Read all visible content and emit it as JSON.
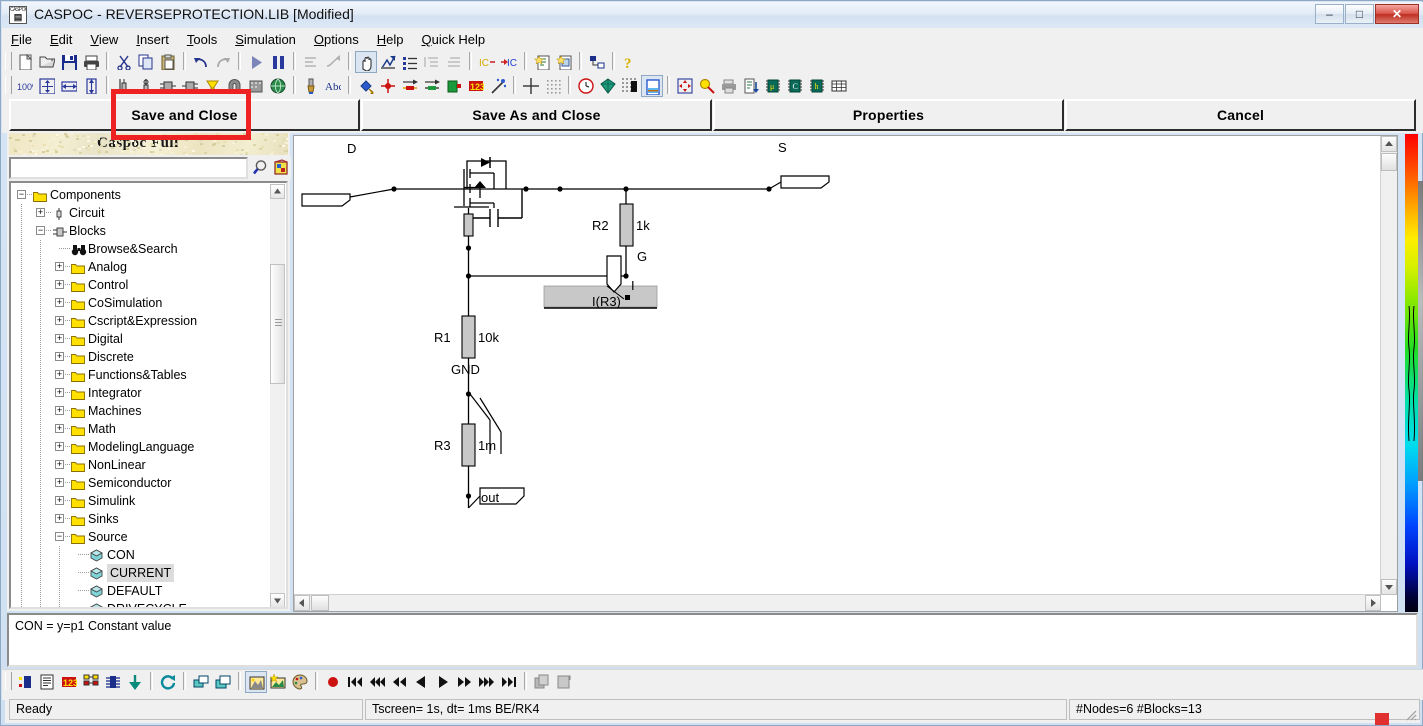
{
  "window": {
    "title": "CASPOC - REVERSEPROTECTION.LIB [Modified]",
    "icon_name": "caspoc-app-icon",
    "minimize_label": "–",
    "maximize_label": "□",
    "close_label": "✕"
  },
  "menu": [
    {
      "label": "File",
      "accel": "F"
    },
    {
      "label": "Edit",
      "accel": "E"
    },
    {
      "label": "View",
      "accel": "V"
    },
    {
      "label": "Insert",
      "accel": "I"
    },
    {
      "label": "Tools",
      "accel": "T"
    },
    {
      "label": "Simulation",
      "accel": "S"
    },
    {
      "label": "Options",
      "accel": "O"
    },
    {
      "label": "Help",
      "accel": "H"
    },
    {
      "label": "Quick Help",
      "accel": "Q"
    }
  ],
  "toolbar_row1": [
    {
      "name": "new-file-icon",
      "title": "New"
    },
    {
      "name": "open-folder-icon",
      "title": "Open"
    },
    {
      "name": "save-disk-icon",
      "title": "Save"
    },
    {
      "name": "print-icon",
      "title": "Print"
    },
    {
      "name": "separator"
    },
    {
      "name": "cut-scissors-icon",
      "title": "Cut"
    },
    {
      "name": "copy-icon",
      "title": "Copy"
    },
    {
      "name": "paste-clipboard-icon",
      "title": "Paste"
    },
    {
      "name": "separator"
    },
    {
      "name": "undo-arrow-icon",
      "title": "Undo"
    },
    {
      "name": "redo-arrow-icon",
      "title": "Redo"
    },
    {
      "name": "separator"
    },
    {
      "name": "play-run-icon",
      "title": "Run"
    },
    {
      "name": "pause-icon",
      "title": "Pause"
    },
    {
      "name": "separator"
    },
    {
      "name": "align-left-icon",
      "title": "Align"
    },
    {
      "name": "wire-route-icon",
      "title": "Route"
    },
    {
      "name": "separator"
    },
    {
      "name": "pan-hand-icon",
      "title": "Pan",
      "pressed": true
    },
    {
      "name": "scope-probe-icon",
      "title": "Scope"
    },
    {
      "name": "list-icon",
      "title": "List"
    },
    {
      "name": "indent-in-icon",
      "title": "Indent"
    },
    {
      "name": "indent-out-icon",
      "title": "Outdent"
    },
    {
      "name": "separator"
    },
    {
      "name": "initial-condition-out-icon",
      "title": "IC out"
    },
    {
      "name": "initial-condition-in-icon",
      "title": "IC in"
    },
    {
      "name": "separator"
    },
    {
      "name": "new-sheet-star-icon",
      "title": "New sheet"
    },
    {
      "name": "new-page-star-icon",
      "title": "New page"
    },
    {
      "name": "separator"
    },
    {
      "name": "hierarchy-icon",
      "title": "Hierarchy"
    },
    {
      "name": "separator"
    },
    {
      "name": "help-question-icon",
      "title": "Help"
    }
  ],
  "toolbar_row2": [
    {
      "name": "zoom-100-icon",
      "title": "100%"
    },
    {
      "name": "zoom-fit-icon",
      "title": "Zoom fit"
    },
    {
      "name": "zoom-width-icon",
      "title": "Zoom width"
    },
    {
      "name": "zoom-height-icon",
      "title": "Zoom height"
    },
    {
      "name": "separator"
    },
    {
      "name": "component-pin-icon",
      "title": "Pin"
    },
    {
      "name": "node-icon",
      "title": "Node"
    },
    {
      "name": "block-in-icon",
      "title": "Block in"
    },
    {
      "name": "block-out-icon",
      "title": "Block out"
    },
    {
      "name": "lamp-icon",
      "title": "Lamp"
    },
    {
      "name": "magnet-icon",
      "title": "Magnet"
    },
    {
      "name": "machine-icon",
      "title": "Machine"
    },
    {
      "name": "globe-icon",
      "title": "Global"
    },
    {
      "name": "separator"
    },
    {
      "name": "paint-brush-icon",
      "title": "Brush"
    },
    {
      "name": "text-abc-icon",
      "title": "Text"
    },
    {
      "name": "separator"
    },
    {
      "name": "color-fill-icon",
      "title": "Fill color"
    },
    {
      "name": "add-node-red-icon",
      "title": "Add node"
    },
    {
      "name": "arrow-red-icon",
      "title": "Signal"
    },
    {
      "name": "arrow-green-icon",
      "title": "Signal green"
    },
    {
      "name": "terminal-green-icon",
      "title": "Terminal"
    },
    {
      "name": "numbers-123-icon",
      "title": "Numbering"
    },
    {
      "name": "wand-icon",
      "title": "Wizard"
    },
    {
      "name": "separator"
    },
    {
      "name": "crosshair-icon",
      "title": "Crosshair"
    },
    {
      "name": "grid-dots-icon",
      "title": "Grid"
    },
    {
      "name": "separator"
    },
    {
      "name": "clock-icon",
      "title": "Clock"
    },
    {
      "name": "gem-icon",
      "title": "Gem"
    },
    {
      "name": "bargraph-icon",
      "title": "Bar graph"
    },
    {
      "name": "scope-window-icon",
      "title": "Scope window",
      "pressed": true
    },
    {
      "name": "separator"
    },
    {
      "name": "move-cross-icon",
      "title": "Move"
    },
    {
      "name": "magnify-scope-icon",
      "title": "Magnify"
    },
    {
      "name": "printer-gray-icon",
      "title": "Print preview"
    },
    {
      "name": "export-list-icon",
      "title": "Export"
    },
    {
      "name": "chip-u-icon",
      "title": "uC"
    },
    {
      "name": "chip-c-icon",
      "title": "C code"
    },
    {
      "name": "chip-h-icon",
      "title": "H code"
    },
    {
      "name": "table-icon",
      "title": "Table"
    }
  ],
  "action_buttons": [
    {
      "name": "save-and-close-button",
      "label": "Save and Close",
      "highlighted": true
    },
    {
      "name": "save-as-and-close-button",
      "label": "Save As and Close"
    },
    {
      "name": "properties-button",
      "label": "Properties"
    },
    {
      "name": "cancel-button",
      "label": "Cancel"
    }
  ],
  "annotation": {
    "color": "#ee2222",
    "target": "Save and Close"
  },
  "left_panel": {
    "banner_text": "Caspoc Full",
    "search": {
      "value": "",
      "placeholder": ""
    },
    "search_buttons": [
      {
        "name": "search-magnifier-icon",
        "title": "Search"
      },
      {
        "name": "library-icon",
        "title": "Library"
      }
    ],
    "tree": [
      {
        "label": "Components",
        "depth": 0,
        "expander": "minus",
        "icon": "folder",
        "selected": false
      },
      {
        "label": "Circuit",
        "depth": 1,
        "expander": "plus",
        "icon": "circuit",
        "selected": false
      },
      {
        "label": "Blocks",
        "depth": 1,
        "expander": "minus",
        "icon": "block",
        "selected": false
      },
      {
        "label": "Browse&Search",
        "depth": 2,
        "expander": "none",
        "icon": "binoculars",
        "selected": false
      },
      {
        "label": "Analog",
        "depth": 2,
        "expander": "plus",
        "icon": "folder",
        "selected": false
      },
      {
        "label": "Control",
        "depth": 2,
        "expander": "plus",
        "icon": "folder",
        "selected": false
      },
      {
        "label": "CoSimulation",
        "depth": 2,
        "expander": "plus",
        "icon": "folder",
        "selected": false
      },
      {
        "label": "Cscript&Expression",
        "depth": 2,
        "expander": "plus",
        "icon": "folder",
        "selected": false
      },
      {
        "label": "Digital",
        "depth": 2,
        "expander": "plus",
        "icon": "folder",
        "selected": false
      },
      {
        "label": "Discrete",
        "depth": 2,
        "expander": "plus",
        "icon": "folder",
        "selected": false
      },
      {
        "label": "Functions&Tables",
        "depth": 2,
        "expander": "plus",
        "icon": "folder",
        "selected": false
      },
      {
        "label": "Integrator",
        "depth": 2,
        "expander": "plus",
        "icon": "folder",
        "selected": false
      },
      {
        "label": "Machines",
        "depth": 2,
        "expander": "plus",
        "icon": "folder",
        "selected": false
      },
      {
        "label": "Math",
        "depth": 2,
        "expander": "plus",
        "icon": "folder",
        "selected": false
      },
      {
        "label": "ModelingLanguage",
        "depth": 2,
        "expander": "plus",
        "icon": "folder",
        "selected": false
      },
      {
        "label": "NonLinear",
        "depth": 2,
        "expander": "plus",
        "icon": "folder",
        "selected": false
      },
      {
        "label": "Semiconductor",
        "depth": 2,
        "expander": "plus",
        "icon": "folder",
        "selected": false
      },
      {
        "label": "Simulink",
        "depth": 2,
        "expander": "plus",
        "icon": "folder",
        "selected": false
      },
      {
        "label": "Sinks",
        "depth": 2,
        "expander": "plus",
        "icon": "folder",
        "selected": false
      },
      {
        "label": "Source",
        "depth": 2,
        "expander": "minus",
        "icon": "folder",
        "selected": false
      },
      {
        "label": "CON",
        "depth": 3,
        "expander": "none",
        "icon": "diamond",
        "selected": false
      },
      {
        "label": "CURRENT",
        "depth": 3,
        "expander": "none",
        "icon": "diamond",
        "selected": true
      },
      {
        "label": "DEFAULT",
        "depth": 3,
        "expander": "none",
        "icon": "diamond",
        "selected": false
      },
      {
        "label": "DRIVECYCLE",
        "depth": 3,
        "expander": "none",
        "icon": "diamond",
        "selected": false
      }
    ]
  },
  "description_pane": {
    "text": "CON = y=p1 Constant value"
  },
  "schematic": {
    "labels": {
      "drain": "D",
      "source": "S",
      "gate": "G",
      "gnd": "GND",
      "r1": "R1",
      "r1_value": "10k",
      "r2": "R2",
      "r2_value": "1k",
      "r3": "R3",
      "r3_value": "1m",
      "out": "out",
      "meter": "I(R3)",
      "current": "I"
    }
  },
  "bottom_toolbar": [
    {
      "name": "show-block-icon",
      "title": "Blocks"
    },
    {
      "name": "document-list-icon",
      "title": "Netlist"
    },
    {
      "name": "numbers-123-icon",
      "title": "Numbering"
    },
    {
      "name": "structure-icon",
      "title": "Structure"
    },
    {
      "name": "ic-chip-icon",
      "title": "Chip"
    },
    {
      "name": "download-arrow-icon",
      "title": "Download"
    },
    {
      "name": "separator"
    },
    {
      "name": "refresh-circle-icon",
      "title": "Refresh"
    },
    {
      "name": "separator"
    },
    {
      "name": "windows-tile-icon",
      "title": "Tile windows"
    },
    {
      "name": "windows-cascade-icon",
      "title": "Cascade windows"
    },
    {
      "name": "separator"
    },
    {
      "name": "image-scope-icon",
      "title": "Scope image",
      "pressed": true
    },
    {
      "name": "image-star-icon",
      "title": "New image"
    },
    {
      "name": "paint-palette-icon",
      "title": "Palette"
    },
    {
      "name": "separator"
    },
    {
      "name": "record-dot-icon",
      "title": "Record"
    },
    {
      "name": "rewind-start-icon",
      "title": "Go to start"
    },
    {
      "name": "rewind-fast-icon",
      "title": "Fast rewind"
    },
    {
      "name": "rewind-icon",
      "title": "Rewind"
    },
    {
      "name": "step-back-icon",
      "title": "Step back"
    },
    {
      "name": "play-icon",
      "title": "Play"
    },
    {
      "name": "forward-icon",
      "title": "Forward"
    },
    {
      "name": "fast-forward-icon",
      "title": "Fast forward"
    },
    {
      "name": "forward-end-icon",
      "title": "Go to end"
    },
    {
      "name": "separator"
    },
    {
      "name": "copy-gray-icon",
      "title": "Copy"
    },
    {
      "name": "duplicate-gray-icon",
      "title": "Duplicate"
    }
  ],
  "status_bar": {
    "ready": "Ready",
    "simulation": "Tscreen= 1s, dt= 1ms BE/RK4",
    "nodes": "#Nodes=6 #Blocks=13"
  }
}
